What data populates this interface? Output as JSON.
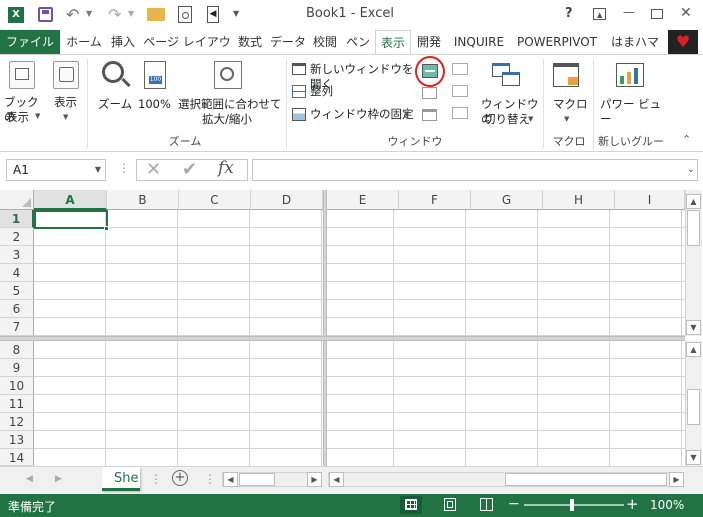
{
  "title_bar": {
    "title": "Book1 - Excel",
    "help_label": "?",
    "minimize_label": "—",
    "close_label": "✕"
  },
  "tabs": [
    {
      "label": "ファイル"
    },
    {
      "label": "ホーム"
    },
    {
      "label": "挿入"
    },
    {
      "label": "ページ レイアウト"
    },
    {
      "label": "数式"
    },
    {
      "label": "データ"
    },
    {
      "label": "校閲"
    },
    {
      "label": "ペン"
    },
    {
      "label": "表示"
    },
    {
      "label": "開発"
    },
    {
      "label": "INQUIRE"
    },
    {
      "label": "POWERPIVOT"
    },
    {
      "label": "はまハマ"
    }
  ],
  "ribbon": {
    "book_view": {
      "line1": "ブックの",
      "line2": "表示"
    },
    "show": {
      "label": "表示"
    },
    "zoom": {
      "label": "ズーム"
    },
    "zoom100": {
      "label": "100%"
    },
    "zoom_to_selection": {
      "line1": "選択範囲に合わせて",
      "line2": "拡大/縮小"
    },
    "zoom_group_label": "ズーム",
    "new_window": {
      "label": "新しいウィンドウを開く"
    },
    "arrange": {
      "label": "整列"
    },
    "freeze_panes": {
      "label": "ウィンドウ枠の固定"
    },
    "switch_windows": {
      "line1": "ウィンドウの",
      "line2": "切り替え"
    },
    "window_group_label": "ウィンドウ",
    "macros": {
      "label": "マクロ"
    },
    "macro_group_label": "マクロ",
    "power_view": {
      "label": "パワー ビュー"
    },
    "new_group_label": "新しいグループ"
  },
  "formula_bar": {
    "name_box": "A1",
    "fx": "fx",
    "formula": ""
  },
  "columns": [
    "A",
    "B",
    "C",
    "D",
    "E",
    "F",
    "G",
    "H",
    "I"
  ],
  "rows_top": [
    "1",
    "2",
    "3",
    "4",
    "5",
    "6",
    "7"
  ],
  "rows_bottom": [
    "8",
    "9",
    "10",
    "11",
    "12",
    "13",
    "14"
  ],
  "sheet_tabs": [
    {
      "label": "She"
    }
  ],
  "status_bar": {
    "status": "準備完了",
    "zoom_percent": "100%"
  },
  "colors": {
    "excel_green": "#217346",
    "selected_tab": "#217346",
    "highlight_circle": "#e02020"
  }
}
